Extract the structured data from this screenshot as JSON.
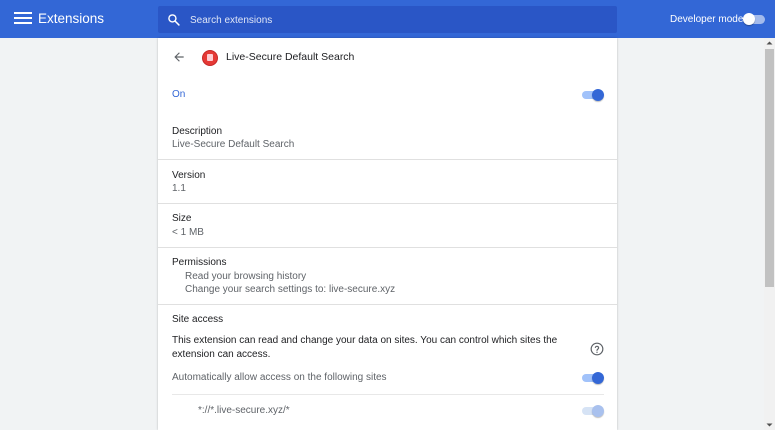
{
  "header": {
    "title": "Extensions",
    "search_placeholder": "Search extensions",
    "developer_mode_label": "Developer mode",
    "developer_mode_on": false
  },
  "extension": {
    "name": "Live-Secure Default Search",
    "status_label": "On",
    "enabled": true,
    "description_title": "Description",
    "description_value": "Live-Secure Default Search",
    "version_title": "Version",
    "version_value": "1.1",
    "size_title": "Size",
    "size_value": "< 1 MB",
    "permissions_title": "Permissions",
    "permissions": [
      "Read your browsing history",
      "Change your search settings to: live-secure.xyz"
    ],
    "site_access": {
      "title": "Site access",
      "description": "This extension can read and change your data on sites. You can control which sites the extension can access.",
      "auto_allow_label": "Automatically allow access on the following sites",
      "auto_allow_on": true,
      "sites": [
        "*://*.live-secure.xyz/*"
      ]
    }
  },
  "colors": {
    "topbar": "#3367d6",
    "accent": "#3367d6",
    "page_bg": "#f1f3f4"
  },
  "icons": [
    "menu-icon",
    "search-icon",
    "back-arrow-icon",
    "extension-icon",
    "help-icon",
    "scroll-up-arrow-icon",
    "scroll-down-arrow-icon"
  ]
}
